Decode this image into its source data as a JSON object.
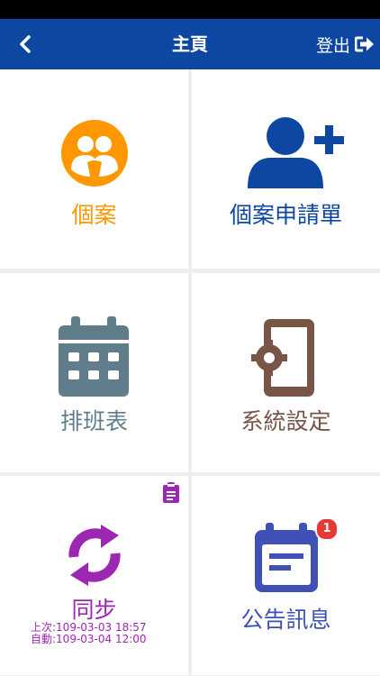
{
  "header": {
    "title": "主頁",
    "logout_label": "登出"
  },
  "tiles": [
    {
      "label": "個案",
      "icon": "users-circle-icon",
      "color": "#ff9800"
    },
    {
      "label": "個案申請單",
      "icon": "user-plus-icon",
      "color": "#0d47a1"
    },
    {
      "label": "排班表",
      "icon": "calendar-icon",
      "color": "#607d8b"
    },
    {
      "label": "系統設定",
      "icon": "mobile-settings-icon",
      "color": "#795548"
    },
    {
      "label": "同步",
      "icon": "sync-icon",
      "color": "#9c27b0"
    },
    {
      "label": "公告訊息",
      "icon": "calendar-note-icon",
      "color": "#3f51b5"
    }
  ],
  "sync": {
    "last_sync": "上次:109-03-03 18:57",
    "auto_sync": "自動:109-03-04 12:00"
  },
  "announcement_badge": "1"
}
